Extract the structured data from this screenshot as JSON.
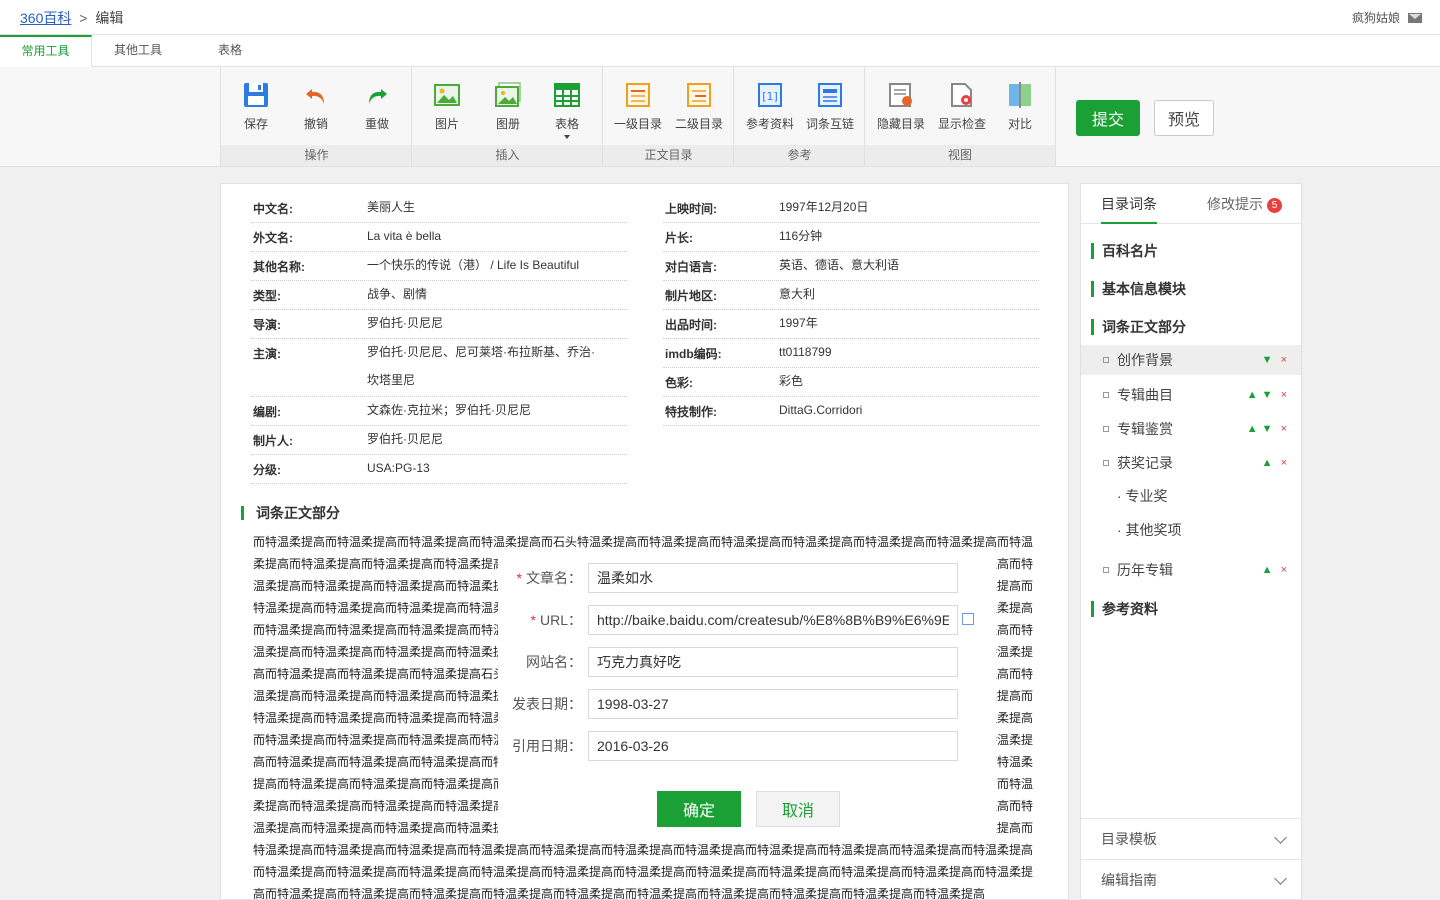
{
  "header": {
    "home_link": "360百科",
    "separator": ">",
    "current": "编辑",
    "username": "疯狗姑娘"
  },
  "tabs": [
    "常用工具",
    "其他工具",
    "表格"
  ],
  "toolbar": {
    "groups": [
      {
        "label": "操作",
        "tools": [
          "保存",
          "撤销",
          "重做"
        ]
      },
      {
        "label": "插入",
        "tools": [
          "图片",
          "图册",
          "表格"
        ]
      },
      {
        "label": "正文目录",
        "tools": [
          "一级目录",
          "二级目录"
        ]
      },
      {
        "label": "参考",
        "tools": [
          "参考资料",
          "词条互链"
        ]
      },
      {
        "label": "视图",
        "tools": [
          "隐藏目录",
          "显示检查",
          "对比"
        ]
      }
    ],
    "submit": "提交",
    "preview": "预览"
  },
  "infobox": {
    "left": [
      {
        "k": "中文名:",
        "v": "美丽人生"
      },
      {
        "k": "外文名:",
        "v": "La vita è bella"
      },
      {
        "k": "其他名称:",
        "v": "一个快乐的传说（港） / Life Is Beautiful"
      },
      {
        "k": "类型:",
        "v": "战争、剧情"
      },
      {
        "k": "导演:",
        "v": "罗伯托·贝尼尼"
      },
      {
        "k": "主演:",
        "v": "罗伯托·贝尼尼、尼可莱塔·布拉斯基、乔治·坎塔里尼"
      },
      {
        "k": "编剧:",
        "v": "文森佐·克拉米；罗伯托·贝尼尼"
      },
      {
        "k": "制片人:",
        "v": "罗伯托·贝尼尼"
      },
      {
        "k": "分级:",
        "v": "USA:PG-13"
      }
    ],
    "right": [
      {
        "k": "上映时间:",
        "v": "1997年12月20日"
      },
      {
        "k": "片长:",
        "v": "116分钟"
      },
      {
        "k": "对白语言:",
        "v": "英语、德语、意大利语"
      },
      {
        "k": "制片地区:",
        "v": "意大利"
      },
      {
        "k": "出品时间:",
        "v": "1997年"
      },
      {
        "k": "imdb编码:",
        "v": "tt0118799"
      },
      {
        "k": "色彩:",
        "v": "彩色"
      },
      {
        "k": "特技制作:",
        "v": "DittaG.Corridori"
      }
    ]
  },
  "body": {
    "section_title": "词条正文部分",
    "text": "而特温柔提高而特温柔提高而特温柔提高而特温柔提高而石头特温柔提高而特温柔提高而特温柔提高而特温柔提高而特温柔提高而特温柔提高而特温柔提高而特温柔提高而特温柔提高而特温柔提高而特温柔提高而特温柔提高而特温柔提高而特温柔提高而特温柔提高而特温柔提高而特温柔提高而特温柔提高而特温柔提高而特温柔提高而特温柔提高而特温柔提高而特温柔提高而特温柔提高而特温柔提高而特温柔提高而特温柔提高而特温柔提高而特温柔提高而特温柔提高而特温柔提高而特温柔提高而特温柔提高而特温柔提高而特温柔提高而特温柔提高而特温柔提高而特温柔提高而特温柔提高而特温柔提高而特温柔提高而特温柔提高而特温柔提高而石头而特温柔提高而特温柔提高而特温柔提高而特温柔提高而特温柔提高而特温柔提高而特温柔提高而特温柔提高而特温柔提高而特温柔提高而特温柔提高而特温石头柔提高而特温柔提高而特温柔提高而特温柔提高而特温柔提高而特温柔提高而特温柔提高而特温柔提高而特温柔提高石头而特温柔提高而特温柔提高而特温柔提高而特温柔提高而特温柔提高而特温柔提高而特温柔提高而特温柔提高而特温柔提高而特温柔提高而特温柔提高而特温柔提高而特温柔提高而特温柔提高而特温柔提高而特温柔提高而特温柔提高而特温柔提高而特温柔提高而特温柔提高而特温柔提高而特温柔提高而特温柔提高而特温柔提高而特温柔提高而特温柔提高而特温柔提高而特温柔提高而特温柔提高而特温柔提高而特温柔提高而特温柔提高而特温柔提高而特温柔提高而特温柔提高而特温柔提高而特温柔提高而特温柔提高而特温柔提高而特温柔提高而特温柔提高而特温柔提高而特温柔提高而特温柔提高而特温柔提高而特温柔提高而特温柔提高而特温柔提高而特温柔提高而特温柔提高而特温柔提高而特温柔提高而特温柔提高而特温柔提高而特温柔提高而特温柔提高而特温柔提高而特温柔提高而特温柔提高而特温柔提高而特温柔提高而特温柔提高而特温柔提高而特温柔提高而特温柔提高而特温柔提高而特温柔提高而特温柔提高而特温柔提高而特温柔提高而特温柔提高而特温柔提高而特温柔提高而特温柔提高而特温柔提高而特温柔提高而特温柔提高而特温柔提高而特温柔提高而特温柔提高而特温柔提高而特温柔提高而特温柔提高而特温柔提高而特温柔提高而特温柔提高而特温柔提高而特温柔提高而特温柔提高而特温柔提高而特温柔提高而特温柔提高而特温柔提高而特温柔提高而特温柔提高而特温柔提高而特温柔提高而特温柔提高而特温柔提高而特温柔提高而特温柔提高而特温柔提高而特温柔提高而特温柔提高而特温柔提高而特温柔提高而特温柔提高而特温柔提高而特温柔提高而特温柔提高而特温柔提高而特温柔提高而特温柔提高而特温柔提高而特温柔提高"
  },
  "dialog": {
    "fields": [
      {
        "label": "文章名：",
        "required": true,
        "value": "温柔如水"
      },
      {
        "label": "URL：",
        "required": true,
        "value": "http://baike.baidu.com/createsub/%E8%8B%B9%E6%9E"
      },
      {
        "label": "网站名：",
        "required": false,
        "value": "巧克力真好吃"
      },
      {
        "label": "发表日期：",
        "required": false,
        "value": "1998-03-27"
      },
      {
        "label": "引用日期：",
        "required": false,
        "value": "2016-03-26"
      }
    ],
    "required_mark": "*",
    "ok": "确定",
    "cancel": "取消"
  },
  "right_panel": {
    "tab_toc": "目录词条",
    "tab_hints": "修改提示",
    "hint_count": "5",
    "toc": {
      "l1_card": "百科名片",
      "l1_basic": "基本信息模块",
      "l1_body": "词条正文部分",
      "l2_1": "创作背景",
      "l2_2": "专辑曲目",
      "l2_3": "专辑鉴赏",
      "l2_4": "获奖记录",
      "l3_1": "· 专业奖",
      "l3_2": "· 其他奖项",
      "l2_5": "历年专辑",
      "l1_ref": "参考资料"
    },
    "up_arrow": "▲",
    "down_arrow": "▼",
    "delete_mark": "×",
    "accordion_template": "目录模板",
    "accordion_guide": "编辑指南"
  }
}
